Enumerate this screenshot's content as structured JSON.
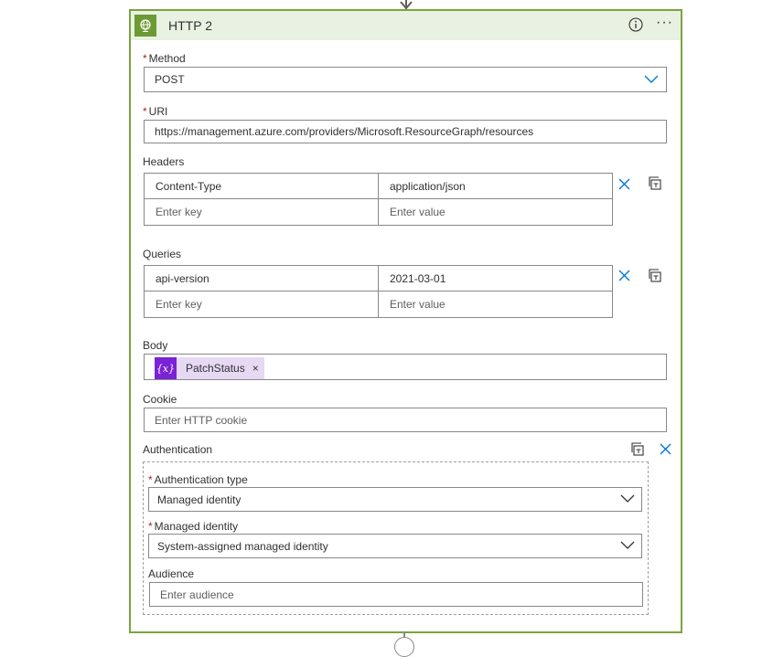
{
  "header": {
    "title": "HTTP 2",
    "more_label": "···"
  },
  "method": {
    "label": "Method",
    "required_mark": "*",
    "value": "POST"
  },
  "uri": {
    "label": "URI",
    "required_mark": "*",
    "value": "https://management.azure.com/providers/Microsoft.ResourceGraph/resources"
  },
  "headers": {
    "label": "Headers",
    "rows": [
      {
        "key": "Content-Type",
        "value": "application/json"
      }
    ],
    "key_placeholder": "Enter key",
    "value_placeholder": "Enter value"
  },
  "queries": {
    "label": "Queries",
    "rows": [
      {
        "key": "api-version",
        "value": "2021-03-01"
      }
    ],
    "key_placeholder": "Enter key",
    "value_placeholder": "Enter value"
  },
  "body": {
    "label": "Body",
    "token": {
      "label": "PatchStatus",
      "icon_text": "{x}",
      "remove": "×"
    }
  },
  "cookie": {
    "label": "Cookie",
    "placeholder": "Enter HTTP cookie"
  },
  "authentication": {
    "label": "Authentication",
    "type": {
      "label": "Authentication type",
      "required_mark": "*",
      "value": "Managed identity"
    },
    "identity": {
      "label": "Managed identity",
      "required_mark": "*",
      "value": "System-assigned managed identity"
    },
    "audience": {
      "label": "Audience",
      "placeholder": "Enter audience"
    }
  },
  "colors": {
    "accent_green": "#7aa43c",
    "header_bg": "#e8f1e2",
    "link_blue": "#0078d4",
    "required_red": "#a4262c",
    "token_purple": "#7a22d6",
    "token_bg": "#e6d9f3"
  },
  "icons": {
    "action": "globe-icon",
    "info": "info-icon",
    "more": "more-icon",
    "delete": "close-icon",
    "copy": "copy-icon",
    "dropdown": "chevron-down-icon"
  }
}
